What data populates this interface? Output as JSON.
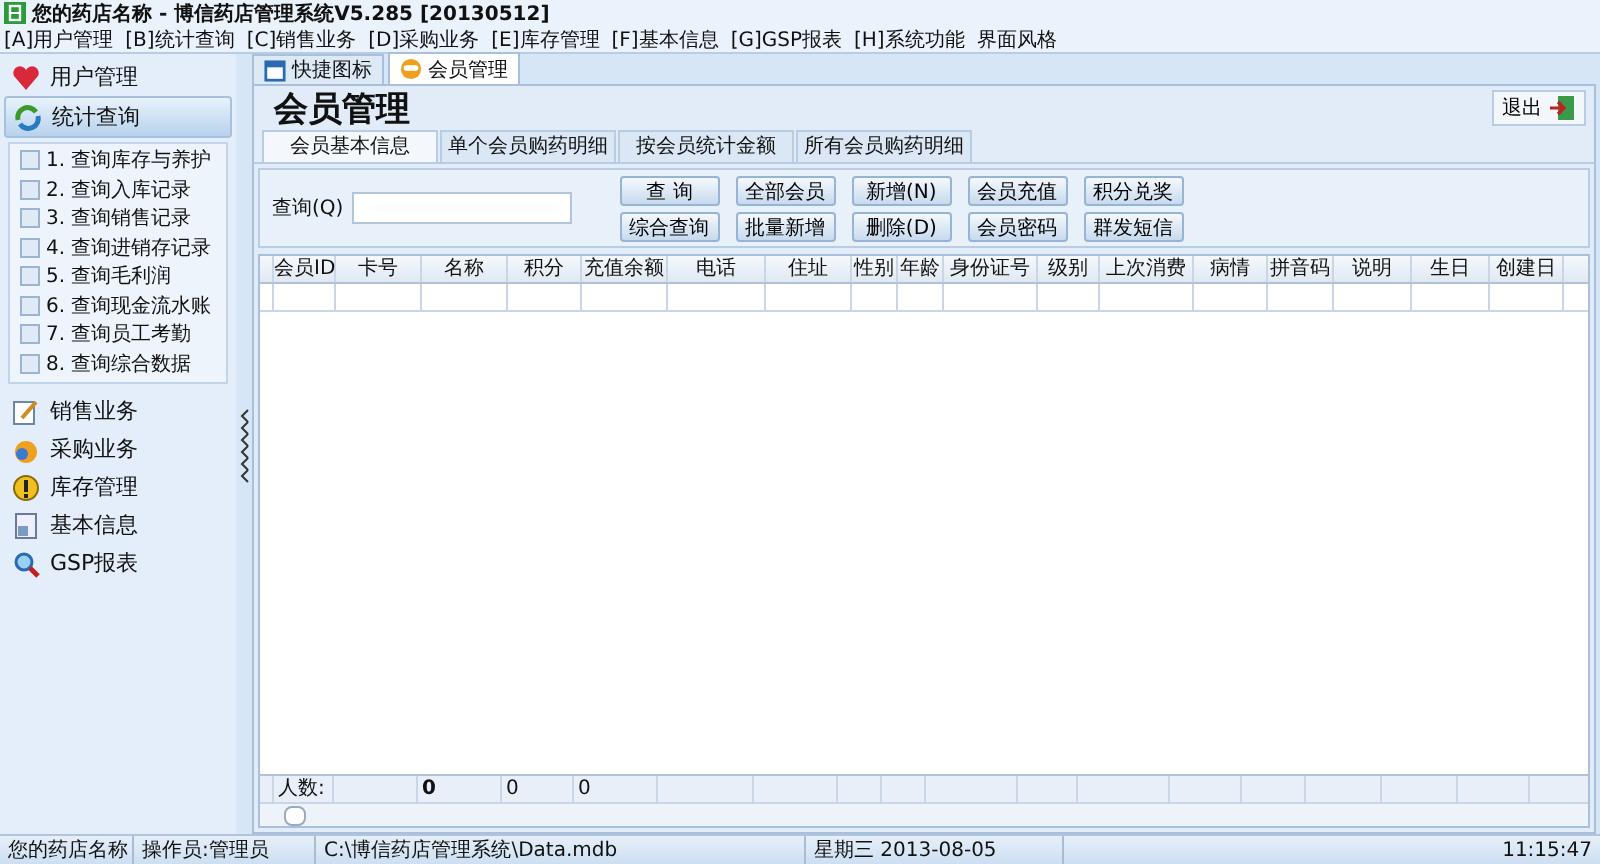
{
  "window": {
    "title": "您的药店名称 - 博信药店管理系统V5.285 [20130512]"
  },
  "menu": [
    "[A]用户管理",
    "[B]统计查询",
    "[C]销售业务",
    "[D]采购业务",
    "[E]库存管理",
    "[F]基本信息",
    "[G]GSP报表",
    "[H]系统功能",
    "界面风格"
  ],
  "sidebar": {
    "sections": [
      {
        "label": "用户管理",
        "selected": false
      },
      {
        "label": "统计查询",
        "selected": true,
        "items": [
          "1. 查询库存与养护",
          "2. 查询入库记录",
          "3. 查询销售记录",
          "4. 查询进销存记录",
          "5. 查询毛利润",
          "6. 查询现金流水账",
          "7. 查询员工考勤",
          "8. 查询综合数据"
        ]
      },
      {
        "label": "销售业务",
        "selected": false
      },
      {
        "label": "采购业务",
        "selected": false
      },
      {
        "label": "库存管理",
        "selected": false
      },
      {
        "label": "基本信息",
        "selected": false
      },
      {
        "label": "GSP报表",
        "selected": false
      }
    ]
  },
  "doc_tabs": [
    {
      "label": "快捷图标",
      "selected": false
    },
    {
      "label": "会员管理",
      "selected": true
    }
  ],
  "page_title": "会员管理",
  "exit_button": "退出",
  "sub_tabs": [
    {
      "label": "会员基本信息",
      "selected": true
    },
    {
      "label": "单个会员购药明细",
      "selected": false
    },
    {
      "label": "按会员统计金额",
      "selected": false
    },
    {
      "label": "所有会员购药明细",
      "selected": false
    }
  ],
  "query": {
    "label": "查询(Q)"
  },
  "buttons": [
    [
      "查 询",
      "全部会员",
      "新增(N)",
      "会员充值",
      "积分兑奖"
    ],
    [
      "综合查询",
      "批量新增",
      "删除(D)",
      "会员密码",
      "群发短信"
    ]
  ],
  "table": {
    "columns": [
      "会员ID",
      "卡号",
      "名称",
      "积分",
      "充值余额",
      "电话",
      "住址",
      "性别",
      "年龄",
      "身份证号",
      "级别",
      "上次消费",
      "病情",
      "拼音码",
      "说明",
      "生日",
      "创建日"
    ],
    "footer": {
      "label": "人数:",
      "values": [
        {
          "text": "0",
          "bold": true
        },
        {
          "text": "0",
          "bold": false
        },
        {
          "text": "0",
          "bold": false
        }
      ]
    }
  },
  "status_bar": [
    "您的药店名称",
    "操作员:管理员",
    "C:\\博信药店管理系统\\Data.mdb",
    "星期三 2013-08-05",
    "11:15:47"
  ]
}
